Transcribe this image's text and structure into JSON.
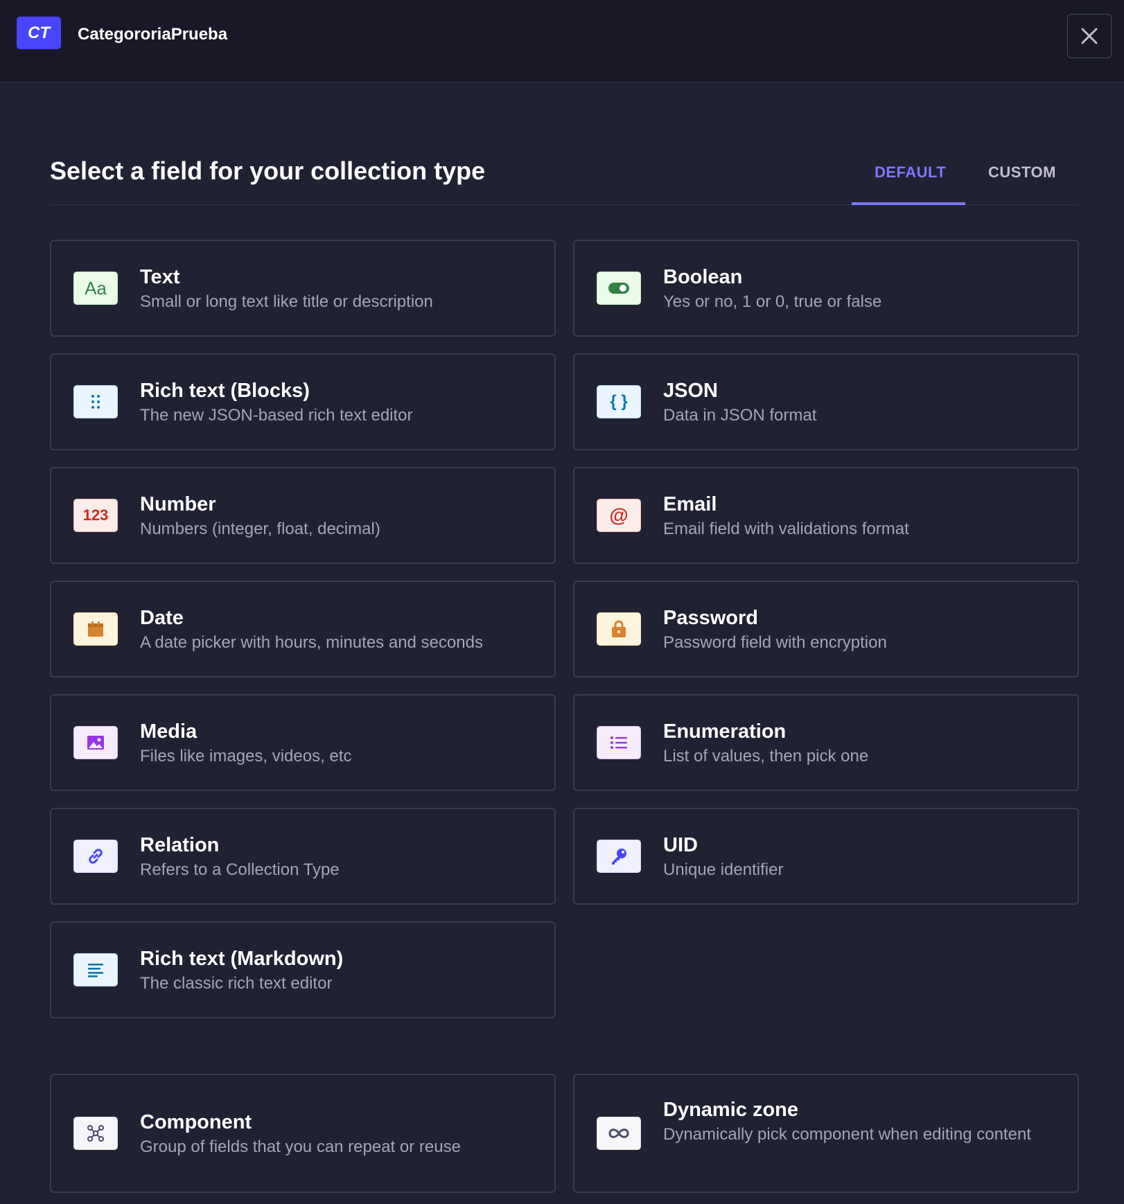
{
  "header": {
    "badge": "CT",
    "title": "CategororiaPrueba"
  },
  "main": {
    "title": "Select a field for your collection type",
    "tabs": [
      {
        "label": "DEFAULT",
        "active": true
      },
      {
        "label": "CUSTOM",
        "active": false
      }
    ]
  },
  "fields": [
    {
      "label": "Text",
      "description": "Small or long text like title or description",
      "icon": "text-icon",
      "icon_text": "Aa"
    },
    {
      "label": "Boolean",
      "description": "Yes or no, 1 or 0, true or false",
      "icon": "toggle-icon"
    },
    {
      "label": "Rich text (Blocks)",
      "description": "The new JSON-based rich text editor",
      "icon": "drag-dots-icon"
    },
    {
      "label": "JSON",
      "description": "Data in JSON format",
      "icon": "braces-icon",
      "icon_text": "{ }"
    },
    {
      "label": "Number",
      "description": "Numbers (integer, float, decimal)",
      "icon": "number-icon",
      "icon_text": "123"
    },
    {
      "label": "Email",
      "description": "Email field with validations format",
      "icon": "at-icon",
      "icon_text": "@"
    },
    {
      "label": "Date",
      "description": "A date picker with hours, minutes and seconds",
      "icon": "calendar-icon"
    },
    {
      "label": "Password",
      "description": "Password field with encryption",
      "icon": "lock-icon"
    },
    {
      "label": "Media",
      "description": "Files like images, videos, etc",
      "icon": "image-icon"
    },
    {
      "label": "Enumeration",
      "description": "List of values, then pick one",
      "icon": "list-icon"
    },
    {
      "label": "Relation",
      "description": "Refers to a Collection Type",
      "icon": "link-icon"
    },
    {
      "label": "UID",
      "description": "Unique identifier",
      "icon": "key-icon"
    },
    {
      "label": "Rich text (Markdown)",
      "description": "The classic rich text editor",
      "icon": "paragraph-icon"
    },
    {
      "label": "Component",
      "description": "Group of fields that you can repeat or reuse",
      "icon": "component-icon"
    },
    {
      "label": "Dynamic zone",
      "description": "Dynamically pick component when editing content",
      "icon": "infinity-icon"
    }
  ],
  "colors": {
    "accent": "#7b79ff",
    "badge": "#4945ff",
    "background": "#212134",
    "header_background": "#181826"
  }
}
